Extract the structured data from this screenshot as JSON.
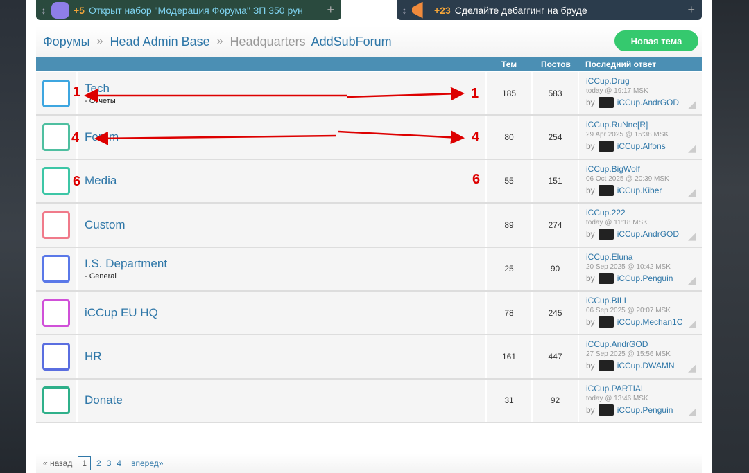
{
  "announcements": [
    {
      "count": "+5",
      "text": "Открыт набор \"Модерация Форума\" ЗП 350 рун"
    },
    {
      "count": "+23",
      "text": "Сделайте дебаггинг на бруде"
    }
  ],
  "breadcrumb": {
    "root": "Форумы",
    "sep": "»",
    "parent": "Head Admin Base",
    "current": "Headquarters",
    "sub": "AddSubForum"
  },
  "new_topic": "Новая тема",
  "headers": {
    "topics": "Тем",
    "posts": "Постов",
    "last": "Последний ответ"
  },
  "forums": [
    {
      "name": "Tech",
      "sub": "- Отчеты",
      "topics": "185",
      "posts": "583",
      "last_title": "iCCup.Drug",
      "last_date": "today @ 19:17 MSK",
      "by": "by",
      "last_user": "iCCup.AndrGOD",
      "color": "#3ea6e0"
    },
    {
      "name": "Forum",
      "sub": "",
      "topics": "80",
      "posts": "254",
      "last_title": "iCCup.RuNne[R]",
      "last_date": "29 Apr 2025 @ 15:38 MSK",
      "by": "by",
      "last_user": "iCCup.Alfons",
      "color": "#4fbfa0"
    },
    {
      "name": "Media",
      "sub": "",
      "topics": "55",
      "posts": "151",
      "last_title": "iCCup.BigWolf",
      "last_date": "06 Oct 2025 @ 20:39 MSK",
      "by": "by",
      "last_user": "iCCup.Kiber",
      "color": "#3dc6a6"
    },
    {
      "name": "Custom",
      "sub": "",
      "topics": "89",
      "posts": "274",
      "last_title": "iCCup.222",
      "last_date": "today @ 11:18 MSK",
      "by": "by",
      "last_user": "iCCup.AndrGOD",
      "color": "#f07a8a"
    },
    {
      "name": "I.S. Department",
      "sub": "- General",
      "topics": "25",
      "posts": "90",
      "last_title": "iCCup.Eluna",
      "last_date": "20 Sep 2025 @ 10:42 MSK",
      "by": "by",
      "last_user": "iCCup.Penguin",
      "color": "#5a78e8"
    },
    {
      "name": "iCCup EU HQ",
      "sub": "",
      "topics": "78",
      "posts": "245",
      "last_title": "iCCup.BILL",
      "last_date": "06 Sep 2025 @ 20:07 MSK",
      "by": "by",
      "last_user": "iCCup.Mechan1C",
      "color": "#d050d8"
    },
    {
      "name": "HR",
      "sub": "",
      "topics": "161",
      "posts": "447",
      "last_title": "iCCup.AndrGOD",
      "last_date": "27 Sep 2025 @ 15:56 MSK",
      "by": "by",
      "last_user": "iCCup.DWAMN",
      "color": "#5a6ee0"
    },
    {
      "name": "Donate",
      "sub": "",
      "topics": "31",
      "posts": "92",
      "last_title": "iCCup.PARTIAL",
      "last_date": "today @ 13:46 MSK",
      "by": "by",
      "last_user": "iCCup.Penguin",
      "color": "#2fb08a"
    }
  ],
  "markers": [
    "1",
    "4",
    "6"
  ],
  "pager": {
    "prev": "« назад",
    "pages": [
      "1",
      "2",
      "3",
      "4"
    ],
    "next": "вперед»"
  }
}
